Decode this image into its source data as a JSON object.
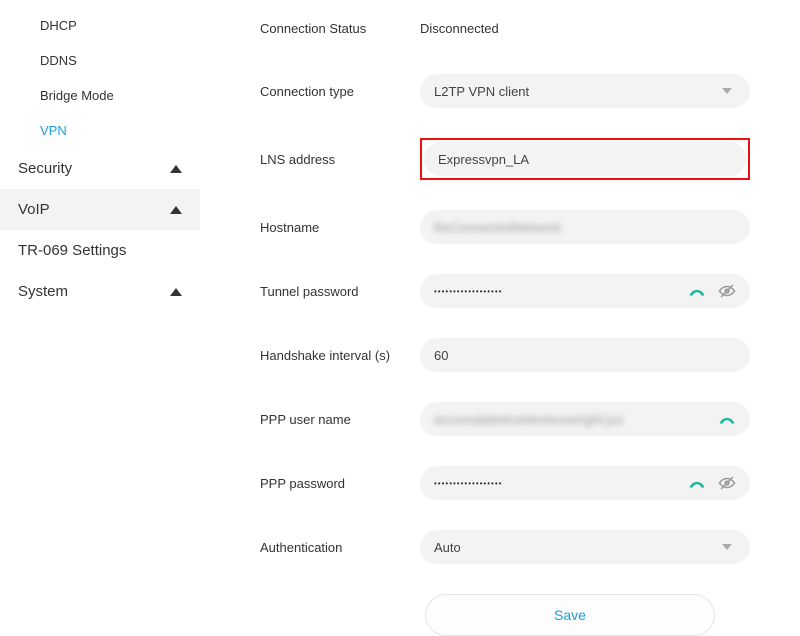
{
  "sidebar": {
    "subItems": [
      {
        "label": "DHCP"
      },
      {
        "label": "DDNS"
      },
      {
        "label": "Bridge Mode"
      },
      {
        "label": "VPN"
      }
    ],
    "sections": [
      {
        "label": "Security"
      },
      {
        "label": "VoIP"
      },
      {
        "label": "TR-069 Settings"
      },
      {
        "label": "System"
      }
    ]
  },
  "form": {
    "connection_status_label": "Connection Status",
    "connection_status_value": "Disconnected",
    "connection_type_label": "Connection type",
    "connection_type_value": "L2TP VPN client",
    "lns_address_label": "LNS address",
    "lns_address_value": "Expressvpn_LA",
    "hostname_label": "Hostname",
    "hostname_value": "ReConnectedNetwork",
    "tunnel_password_label": "Tunnel password",
    "tunnel_password_value": "••••••••••••••••••",
    "handshake_interval_label": "Handshake interval (s)",
    "handshake_interval_value": "60",
    "ppp_username_label": "PPP user name",
    "ppp_username_value": "accumulatedcontentsuseright.jus",
    "ppp_password_label": "PPP password",
    "ppp_password_value": "••••••••••••••••••",
    "authentication_label": "Authentication",
    "authentication_value": "Auto",
    "save_label": "Save"
  },
  "colors": {
    "accent": "#1a9fd9",
    "highlight_border": "#e81010"
  }
}
